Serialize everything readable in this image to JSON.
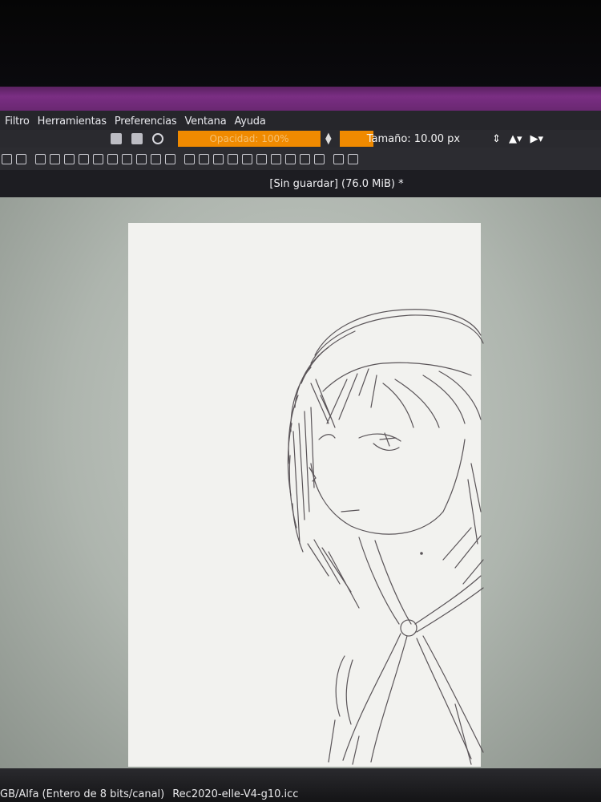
{
  "menu": {
    "items": [
      "Filtro",
      "Herramientas",
      "Preferencias",
      "Ventana",
      "Ayuda"
    ]
  },
  "tool_options": {
    "opacity_label": "Opacidad: 100%",
    "size_label": "Tamaño: 10.00 px"
  },
  "document_tab": {
    "title": "[Sin guardar]  (76.0 MiB) *"
  },
  "status_bar": {
    "color_info": "GB/Alfa (Entero de 8 bits/canal)",
    "profile": "Rec2020-elle-V4-g10.icc"
  },
  "colors": {
    "titlebar": "#7a2e83",
    "accent": "#f08a00",
    "canvas": "#f2f2ef",
    "sketch_stroke": "#4a4448"
  },
  "icons": [
    "brush-preset-icon",
    "pattern-icon",
    "circle-icon",
    "triangle-icon",
    "arrow-right-icon"
  ]
}
